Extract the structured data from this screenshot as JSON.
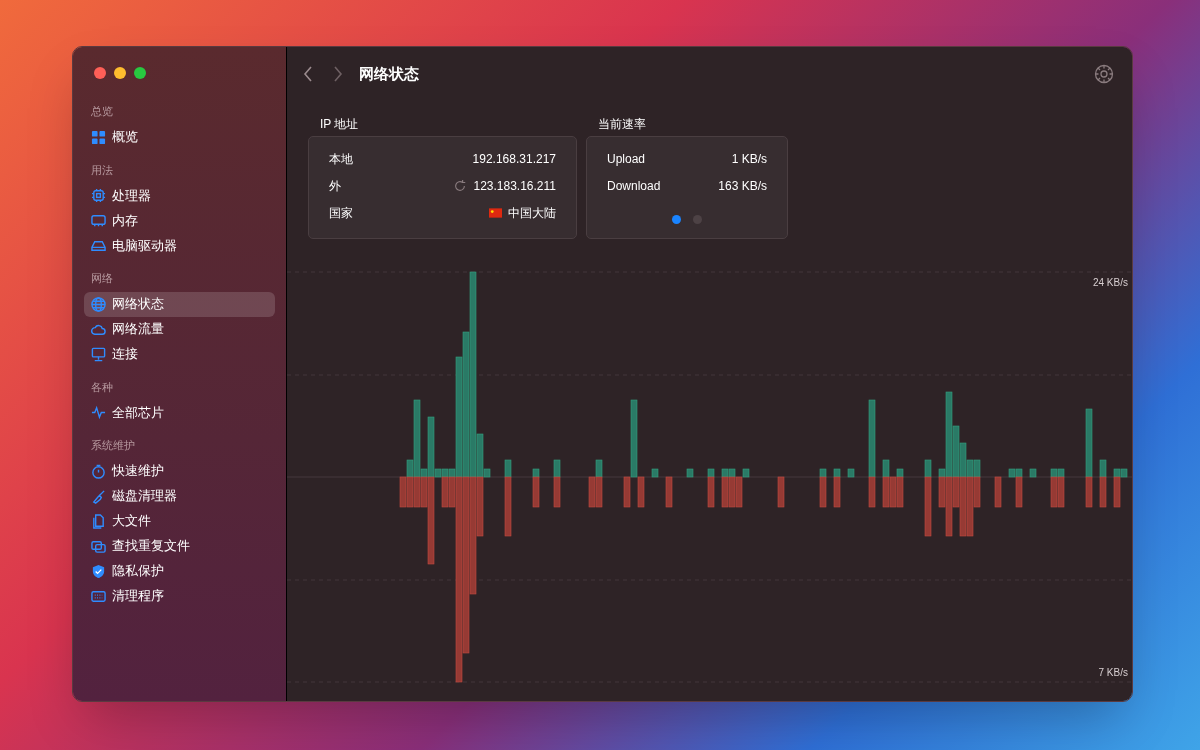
{
  "sidebar": {
    "sections": [
      {
        "title": "总览",
        "items": [
          {
            "label": "概览",
            "selected": false
          }
        ]
      },
      {
        "title": "用法",
        "items": [
          {
            "label": "处理器",
            "selected": false
          },
          {
            "label": "内存",
            "selected": false
          },
          {
            "label": "电脑驱动器",
            "selected": false
          }
        ]
      },
      {
        "title": "网络",
        "items": [
          {
            "label": "网络状态",
            "selected": true
          },
          {
            "label": "网络流量",
            "selected": false
          },
          {
            "label": "连接",
            "selected": false
          }
        ]
      },
      {
        "title": "各种",
        "items": [
          {
            "label": "全部芯片",
            "selected": false
          }
        ]
      },
      {
        "title": "系统维护",
        "items": [
          {
            "label": "快速维护",
            "selected": false
          },
          {
            "label": "磁盘清理器",
            "selected": false
          },
          {
            "label": "大文件",
            "selected": false
          },
          {
            "label": "查找重复文件",
            "selected": false
          },
          {
            "label": "隐私保护",
            "selected": false
          },
          {
            "label": "清理程序",
            "selected": false
          }
        ]
      }
    ]
  },
  "header": {
    "title": "网络状态"
  },
  "ip_card": {
    "title": "IP 地址",
    "rows": [
      {
        "kind": "plain",
        "label": "本地",
        "value": "192.168.31.217"
      },
      {
        "kind": "refresh",
        "label": "外",
        "value": "123.183.16.211"
      },
      {
        "kind": "flag",
        "label": "国家",
        "value": "中国大陆"
      }
    ]
  },
  "speed_card": {
    "title": "当前速率",
    "rows": [
      {
        "label": "Upload",
        "value": "1 KB/s"
      },
      {
        "label": "Download",
        "value": "163 KB/s"
      }
    ],
    "page_dots": [
      {
        "selected": true
      },
      {
        "selected": false
      }
    ]
  },
  "chart": {
    "top_label": "24 KB/s",
    "bottom_label": "7 KB/s"
  }
}
